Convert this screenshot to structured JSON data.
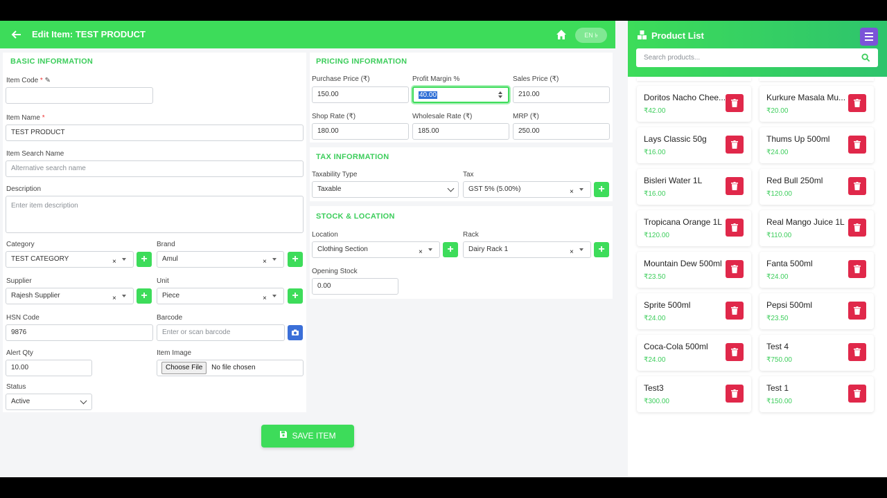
{
  "header": {
    "title": "Edit Item: TEST PRODUCT",
    "toggle_label": "EN ৳"
  },
  "basic": {
    "section_title": "BASIC INFORMATION",
    "item_code_label": "Item Code",
    "item_code_value": "",
    "item_name_label": "Item Name",
    "item_name_value": "TEST PRODUCT",
    "search_name_label": "Item Search Name",
    "search_name_placeholder": "Alternative search name",
    "description_label": "Description",
    "description_placeholder": "Enter item description",
    "category_label": "Category",
    "category_value": "TEST CATEGORY",
    "brand_label": "Brand",
    "brand_value": "Amul",
    "supplier_label": "Supplier",
    "supplier_value": "Rajesh Supplier",
    "unit_label": "Unit",
    "unit_value": "Piece",
    "hsn_label": "HSN Code",
    "hsn_value": "9876",
    "barcode_label": "Barcode",
    "barcode_placeholder": "Enter or scan barcode",
    "alert_qty_label": "Alert Qty",
    "alert_qty_value": "10.00",
    "item_image_label": "Item Image",
    "choose_file_label": "Choose File",
    "no_file_label": "No file chosen",
    "status_label": "Status",
    "status_value": "Active"
  },
  "pricing": {
    "section_title": "PRICING INFORMATION",
    "purchase_label": "Purchase Price (₹)",
    "purchase_value": "150.00",
    "margin_label": "Profit Margin %",
    "margin_value": "40.00",
    "sales_label": "Sales Price (₹)",
    "sales_value": "210.00",
    "shop_label": "Shop Rate (₹)",
    "shop_value": "180.00",
    "wholesale_label": "Wholesale Rate (₹)",
    "wholesale_value": "185.00",
    "mrp_label": "MRP (₹)",
    "mrp_value": "250.00"
  },
  "tax": {
    "section_title": "TAX INFORMATION",
    "taxability_label": "Taxability Type",
    "taxability_value": "Taxable",
    "tax_label": "Tax",
    "tax_value": "GST 5% (5.00%)"
  },
  "stock": {
    "section_title": "STOCK & LOCATION",
    "location_label": "Location",
    "location_value": "Clothing Section",
    "rack_label": "Rack",
    "rack_value": "Dairy Rack 1",
    "opening_label": "Opening Stock",
    "opening_value": "0.00"
  },
  "save_label": "SAVE ITEM",
  "panel": {
    "title": "Product List",
    "search_placeholder": "Search products...",
    "products": [
      {
        "name": "Doritos Nacho Chee...",
        "price": "₹42.00"
      },
      {
        "name": "Kurkure Masala Mu...",
        "price": "₹20.00"
      },
      {
        "name": "Lays Classic 50g",
        "price": "₹16.00"
      },
      {
        "name": "Thums Up 500ml",
        "price": "₹24.00"
      },
      {
        "name": "Bisleri Water 1L",
        "price": "₹16.00"
      },
      {
        "name": "Red Bull 250ml",
        "price": "₹120.00"
      },
      {
        "name": "Tropicana Orange 1L",
        "price": "₹120.00"
      },
      {
        "name": "Real Mango Juice 1L",
        "price": "₹110.00"
      },
      {
        "name": "Mountain Dew 500ml",
        "price": "₹23.50"
      },
      {
        "name": "Fanta 500ml",
        "price": "₹24.00"
      },
      {
        "name": "Sprite 500ml",
        "price": "₹24.00"
      },
      {
        "name": "Pepsi 500ml",
        "price": "₹23.50"
      },
      {
        "name": "Coca-Cola 500ml",
        "price": "₹24.00"
      },
      {
        "name": "Test 4",
        "price": "₹750.00"
      },
      {
        "name": "Test3",
        "price": "₹300.00"
      },
      {
        "name": "Test 1",
        "price": "₹150.00"
      }
    ]
  },
  "colors": {
    "accent": "#3ddc5a",
    "delete": "#e0284a",
    "menu": "#7b54d8",
    "camera": "#3b6fd8"
  }
}
